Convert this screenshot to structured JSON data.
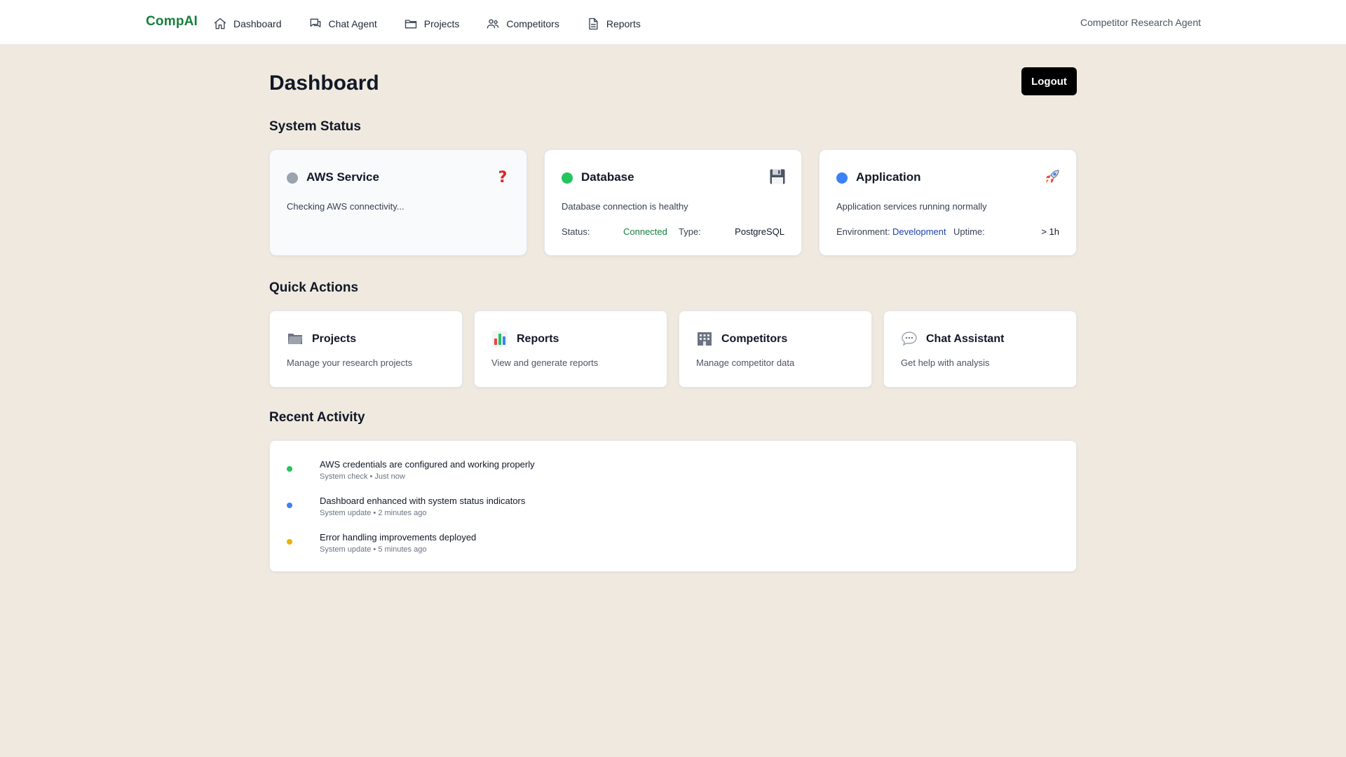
{
  "brand": "CompAI",
  "nav": [
    {
      "label": "Dashboard",
      "icon": "home-icon"
    },
    {
      "label": "Chat Agent",
      "icon": "chat-icon"
    },
    {
      "label": "Projects",
      "icon": "folder-icon"
    },
    {
      "label": "Competitors",
      "icon": "users-icon"
    },
    {
      "label": "Reports",
      "icon": "document-icon"
    }
  ],
  "nav_right": "Competitor Research Agent",
  "page": {
    "title": "Dashboard",
    "logout_label": "Logout"
  },
  "system_status": {
    "title": "System Status",
    "cards": [
      {
        "name": "AWS Service",
        "dot_color": "#9ca3af",
        "icon": "question-mark-icon",
        "description": "Checking AWS connectivity..."
      },
      {
        "name": "Database",
        "dot_color": "#22c55e",
        "icon": "floppy-disk-icon",
        "description": "Database connection is healthy",
        "meta": [
          {
            "label": "Status:",
            "value": "Connected",
            "value_color": "#15803d"
          },
          {
            "label": "Type:",
            "value": "PostgreSQL",
            "value_color": "#111827"
          }
        ]
      },
      {
        "name": "Application",
        "dot_color": "#3b82f6",
        "icon": "rocket-icon",
        "description": "Application services running normally",
        "meta": [
          {
            "label": "Environment:",
            "value": "Development",
            "value_color": "#1e40af"
          },
          {
            "label": "Uptime:",
            "value": "> 1h",
            "value_color": "#111827"
          }
        ]
      }
    ]
  },
  "quick_actions": {
    "title": "Quick Actions",
    "cards": [
      {
        "title": "Projects",
        "description": "Manage your research projects",
        "icon": "folder-icon"
      },
      {
        "title": "Reports",
        "description": "View and generate reports",
        "icon": "bar-chart-icon"
      },
      {
        "title": "Competitors",
        "description": "Manage competitor data",
        "icon": "office-building-icon"
      },
      {
        "title": "Chat Assistant",
        "description": "Get help with analysis",
        "icon": "speech-bubble-icon"
      }
    ]
  },
  "recent_activity": {
    "title": "Recent Activity",
    "items": [
      {
        "text": "AWS credentials are configured and working properly",
        "sub": "System check • Just now",
        "dot_color": "#22c55e"
      },
      {
        "text": "Dashboard enhanced with system status indicators",
        "sub": "System update • 2 minutes ago",
        "dot_color": "#3b82f6"
      },
      {
        "text": "Error handling improvements deployed",
        "sub": "System update • 5 minutes ago",
        "dot_color": "#eab308"
      }
    ]
  }
}
